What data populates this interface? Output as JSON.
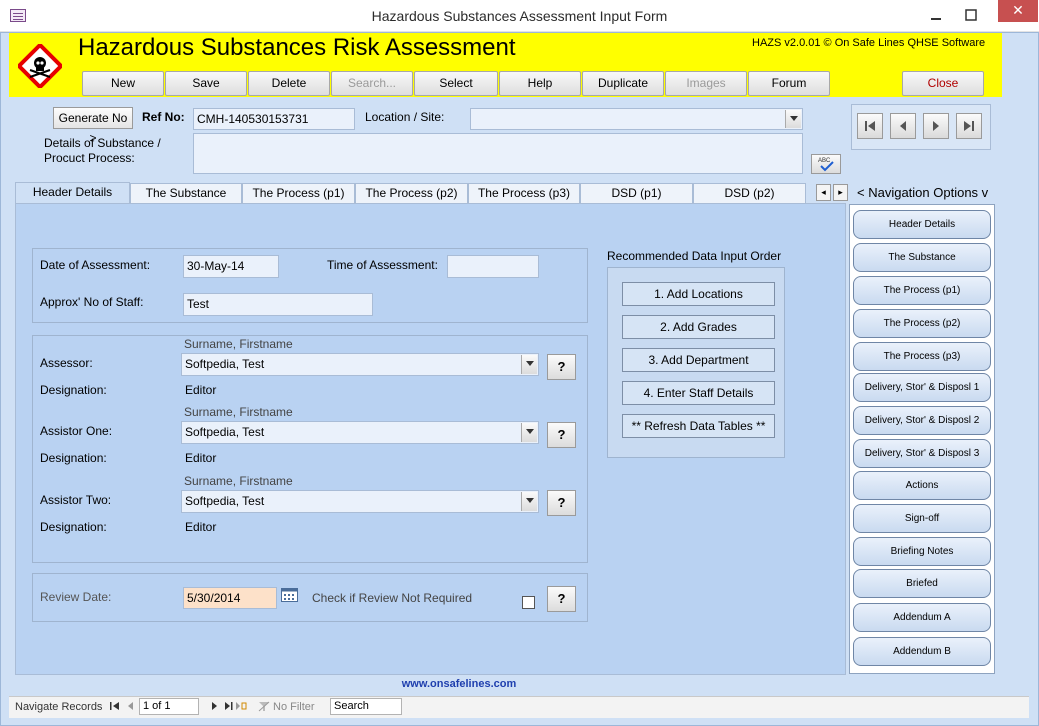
{
  "window": {
    "title": "Hazardous Substances Assessment Input Form",
    "close_glyph": "✕"
  },
  "header": {
    "app_title": "Hazardous Substances Risk Assessment",
    "version": "HAZS v2.0.01 © On Safe Lines QHSE Software",
    "toolbar": {
      "new": "New",
      "save": "Save",
      "delete": "Delete",
      "search": "Search...",
      "select": "Select",
      "help": "Help",
      "duplicate": "Duplicate",
      "images": "Images",
      "forum": "Forum",
      "close": "Close"
    }
  },
  "top": {
    "generate_label": "Generate No >",
    "ref_label": "Ref No:",
    "ref_value": "CMH-140530153731",
    "location_label": "Location / Site:",
    "location_value": "",
    "details_label_1": "Details of Substance /",
    "details_label_2": "Procuct Process:",
    "details_value": "",
    "spell_label": "ABC"
  },
  "record_nav": {
    "first": "⏮",
    "prev": "◀",
    "next": "▶",
    "last": "⏭"
  },
  "tabs": [
    {
      "label": "Header Details"
    },
    {
      "label": "The Substance"
    },
    {
      "label": "The Process (p1)"
    },
    {
      "label": "The Process (p2)"
    },
    {
      "label": "The Process (p3)"
    },
    {
      "label": "DSD (p1)"
    },
    {
      "label": "DSD (p2)"
    }
  ],
  "tab_scroll": {
    "left": "◂",
    "right": "▸"
  },
  "navigation_title": "< Navigation Options v",
  "header_details": {
    "date_label": "Date of Assessment:",
    "date_value": "30-May-14",
    "time_label": "Time of Assessment:",
    "time_value": "",
    "staff_label": "Approx' No of Staff:",
    "staff_value": "Test",
    "surname_hint": "Surname, Firstname",
    "assessor_label": "Assessor:",
    "assessor_value": "Softpedia, Test",
    "designation_label": "Designation:",
    "assessor_designation": "Editor",
    "assistor_one_label": "Assistor One:",
    "assistor_one_value": "Softpedia, Test",
    "assistor_one_designation": "Editor",
    "assistor_two_label": "Assistor Two:",
    "assistor_two_value": "Softpedia, Test",
    "assistor_two_designation": "Editor",
    "help_glyph": "?",
    "review_label": "Review Date:",
    "review_value": "5/30/2014",
    "review_check_label": "Check if Review Not Required"
  },
  "recommended": {
    "title": "Recommended Data Input Order",
    "buttons": [
      "1. Add Locations",
      "2. Add Grades",
      "3. Add Department",
      "4. Enter Staff Details",
      "** Refresh Data Tables **"
    ]
  },
  "side_nav": [
    "Header Details",
    "The Substance",
    "The Process (p1)",
    "The Process (p2)",
    "The Process (p3)",
    "Delivery, Stor' & Disposl 1",
    "Delivery, Stor' & Disposl 2",
    "Delivery, Stor' & Disposl 3",
    "Actions",
    "Sign-off",
    "Briefing Notes",
    "Briefed",
    "Addendum A",
    "Addendum B"
  ],
  "footer_url": "www.onsafelines.com",
  "statusbar": {
    "navigate_label": "Navigate Records",
    "record_position": "1 of 1",
    "filter_label": "No Filter",
    "search_label": "Search"
  },
  "colors": {
    "header_bg": "#ffff00",
    "form_bg": "#cfe0f5",
    "hazard_red": "#e60000"
  }
}
